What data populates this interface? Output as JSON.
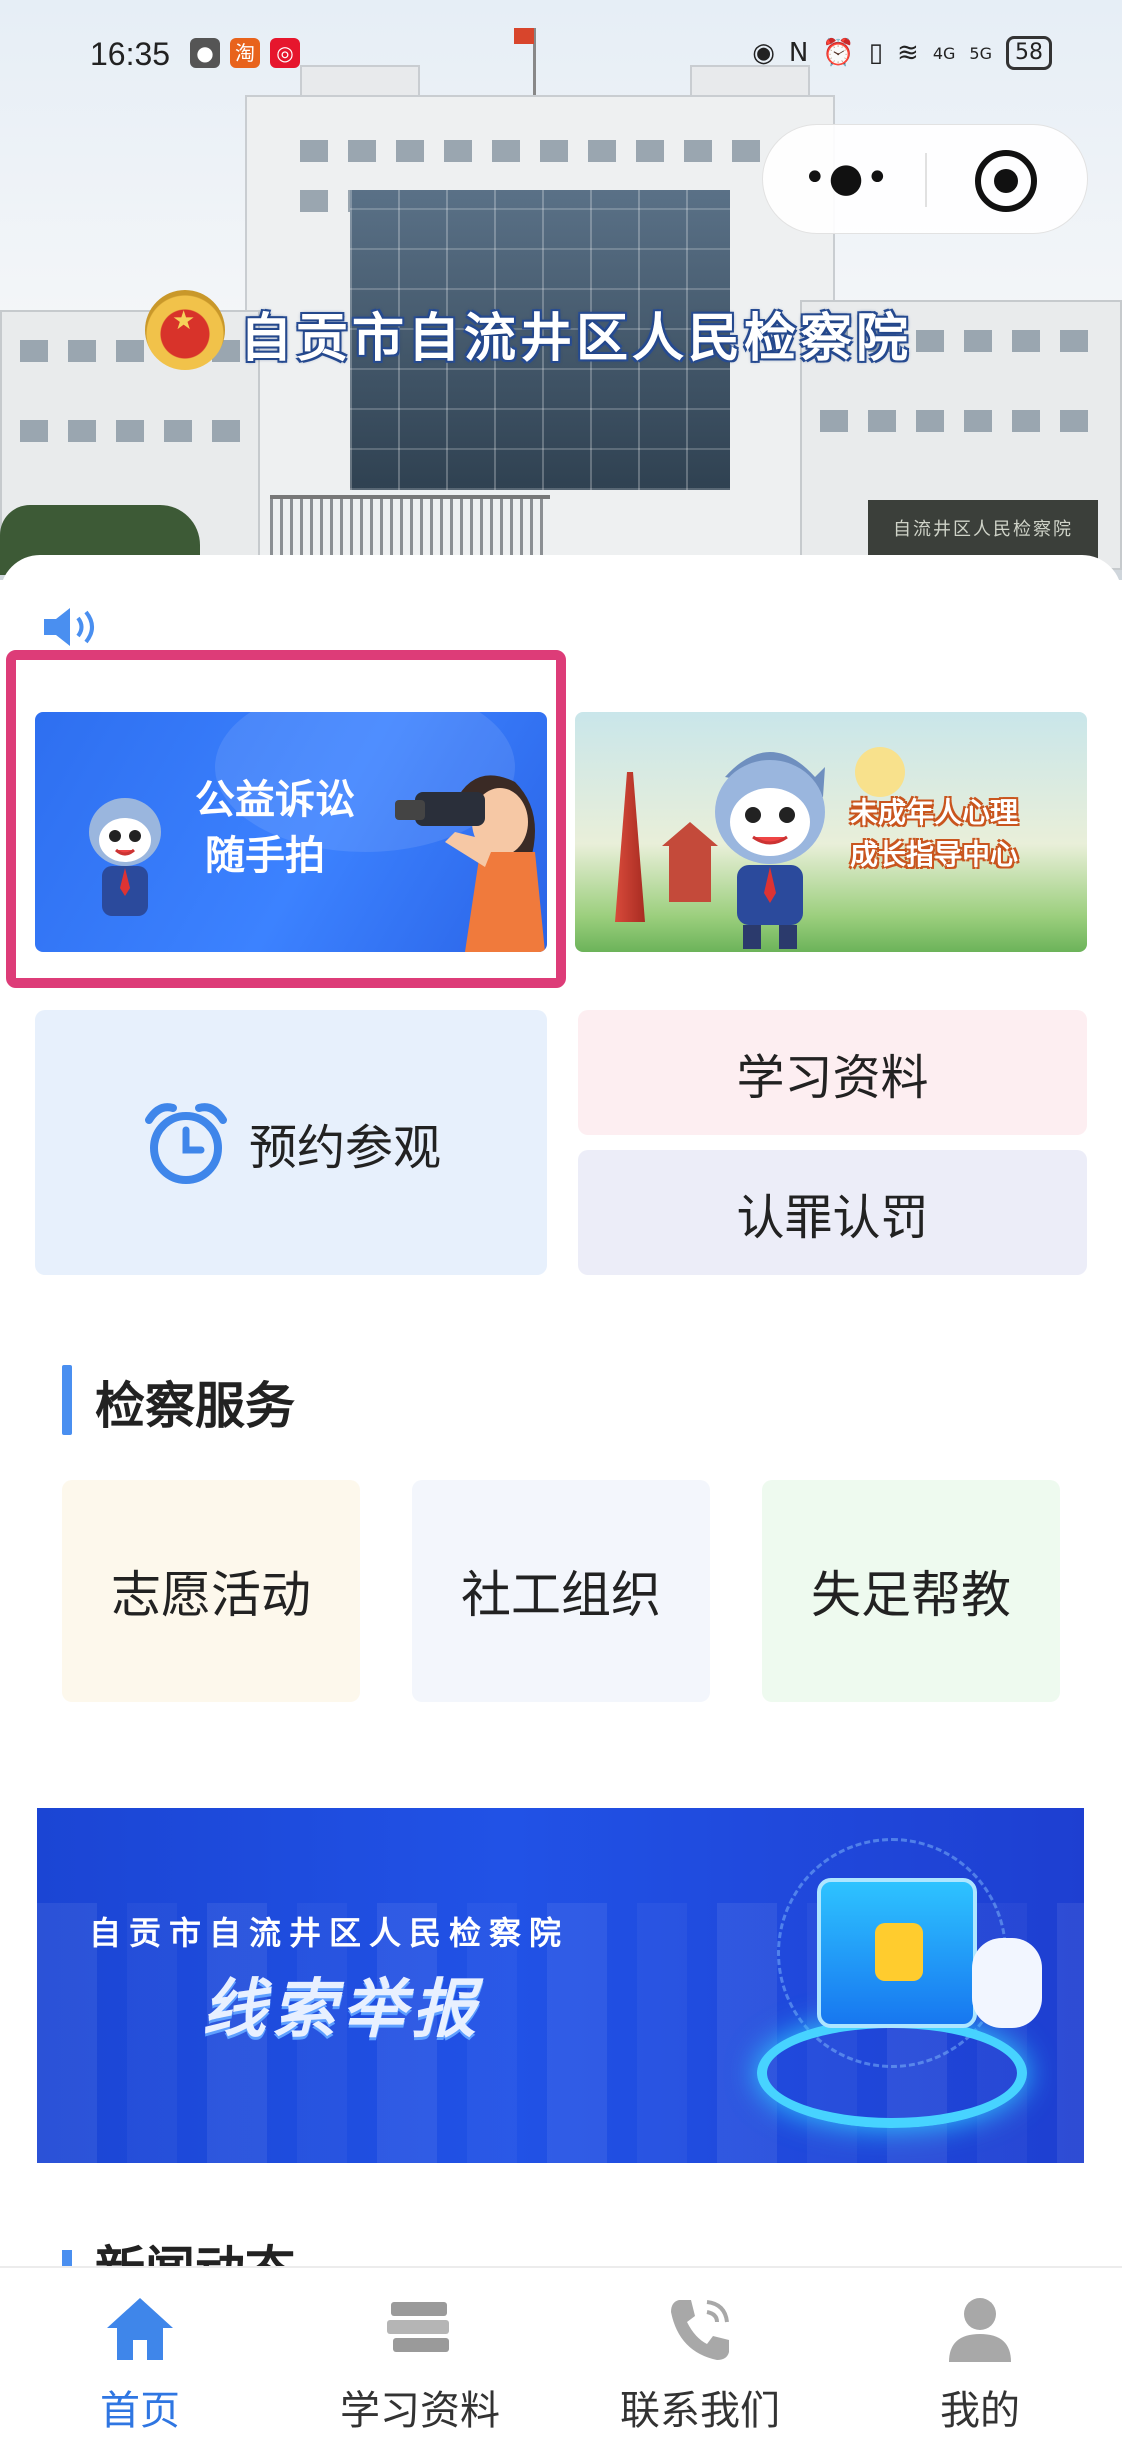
{
  "status_bar": {
    "time": "16:35",
    "battery": "58",
    "network_1": "4G",
    "network_2": "5G"
  },
  "header": {
    "hero_title": "自贡市自流井区人民检察院",
    "plaque_text": "自流井区人民检察院",
    "menu_icon": "more-dots-icon",
    "close_icon": "target-close-icon"
  },
  "banners": {
    "public_interest": {
      "line1": "公益诉讼",
      "line2": "随手拍"
    },
    "youth_center": {
      "line1": "未成年人心理",
      "line2": "成长指导中心"
    }
  },
  "quick_links": {
    "book_visit": "预约参观",
    "study_materials": "学习资料",
    "plea": "认罪认罚"
  },
  "services": {
    "title": "检察服务",
    "items": [
      "志愿活动",
      "社工组织",
      "失足帮教"
    ]
  },
  "report_banner": {
    "subtitle": "自贡市自流井区人民检察院",
    "title": "线索举报"
  },
  "news_section": {
    "title": "新闻动态"
  },
  "tabbar": {
    "items": [
      {
        "label": "首页",
        "icon": "home-icon"
      },
      {
        "label": "学习资料",
        "icon": "books-icon"
      },
      {
        "label": "联系我们",
        "icon": "phone-icon"
      },
      {
        "label": "我的",
        "icon": "user-icon"
      }
    ]
  },
  "colors": {
    "accent": "#2f76e2",
    "highlight_border": "#dd3c78",
    "section_bar": "#4a8ff0"
  }
}
